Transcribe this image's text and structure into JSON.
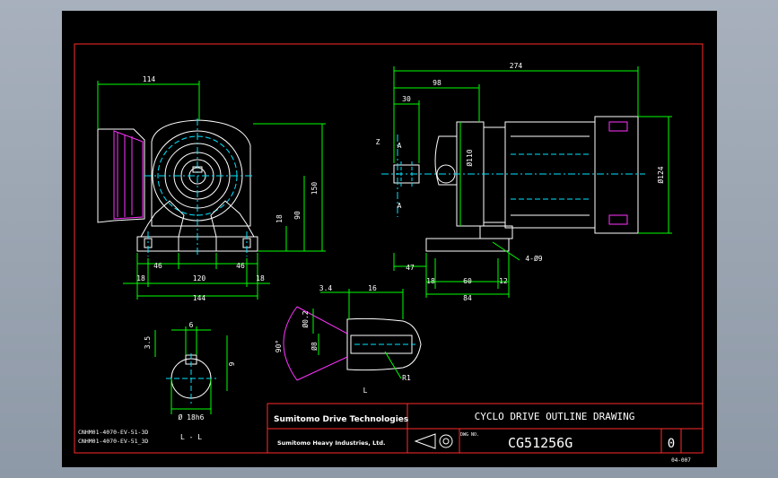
{
  "colors": {
    "background": "#000000",
    "frame": "#ff2a2a",
    "outline": "#ffffff",
    "dimension": "#00ff00",
    "centerline": "#00e5ff",
    "hatch": "#ff33ff",
    "text": "#ffffff",
    "accent": "#ffff00"
  },
  "dimensions": {
    "front_width": "114",
    "front_height_total": "150",
    "front_height_mid": "90",
    "front_height_low": "18",
    "base_left": "46",
    "base_right": "46",
    "base_mid": "120",
    "base_edge_left": "18",
    "base_edge_right": "18",
    "base_total": "144",
    "side_total": "274",
    "side_shaft": "98",
    "side_key": "30",
    "side_dia_110": "Ø110",
    "side_dia_124": "Ø124",
    "side_base_47": "47",
    "side_base_18": "18",
    "side_base_60": "60",
    "side_base_12": "12",
    "side_base_84": "84",
    "side_holes": "4-Ø9",
    "shaft_3_4": "3.4",
    "shaft_16": "16",
    "shaft_dia": "Ø0.2",
    "shaft_d8": "Ø8",
    "shaft_angle": "90°",
    "shaft_r": "R1",
    "key_6": "6",
    "key_3_5": "3.5",
    "key_9": "9",
    "key_dia": "Ø 18h6",
    "label_a": "A",
    "label_z": "Z",
    "label_l": "L"
  },
  "section_label": "L - L",
  "model_lines": [
    "CNHM01-4070-EV-51-3D",
    "CNHM01-4070-EV-51_3D"
  ],
  "title_block": {
    "brand": "Sumitomo Drive Technologies",
    "company": "Sumitomo Heavy Industries, Ltd.",
    "drawing_title": "CYCLO DRIVE OUTLINE DRAWING",
    "dwg_no_label": "DWG NO.",
    "drawing_number": "CG51256G",
    "revision": "0",
    "sheet_code": "04-007"
  }
}
